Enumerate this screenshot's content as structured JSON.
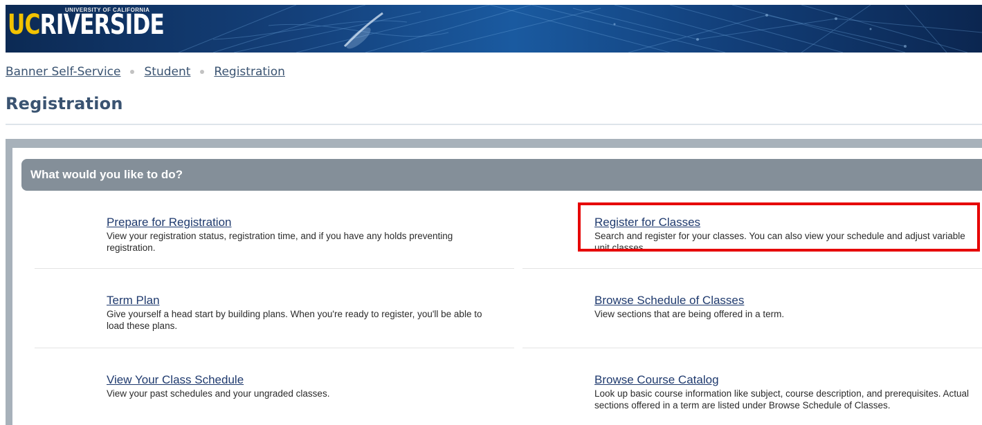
{
  "header": {
    "logo_uc": "UC",
    "logo_riverside": "RIVERSIDE",
    "logo_subtitle": "UNIVERSITY OF CALIFORNIA"
  },
  "breadcrumb": [
    "Banner Self-Service",
    "Student",
    "Registration"
  ],
  "page_title": "Registration",
  "panel": {
    "heading": "What would you like to do?",
    "items": [
      {
        "title": "Prepare for Registration",
        "description": "View your registration status, registration time, and if you have any holds preventing registration."
      },
      {
        "title": "Register for Classes",
        "description": "Search and register for your classes. You can also view your schedule and adjust variable unit classes."
      },
      {
        "title": "Term Plan",
        "description": "Give yourself a head start by building plans. When you're ready to register, you'll be able to load these plans."
      },
      {
        "title": "Browse Schedule of Classes",
        "description": "View sections that are being offered in a term."
      },
      {
        "title": "View Your Class Schedule",
        "description": "View your past schedules and your ungraded classes."
      },
      {
        "title": "Browse Course Catalog",
        "description": "Look up basic course information like subject, course description, and prerequisites. Actual sections offered in a term are listed under Browse Schedule of Classes."
      }
    ]
  },
  "colors": {
    "banner": "#14407a",
    "logo_gold": "#f2c200",
    "panel_header": "#848f99",
    "highlight": "#e60000",
    "link": "#1f3a6e"
  }
}
